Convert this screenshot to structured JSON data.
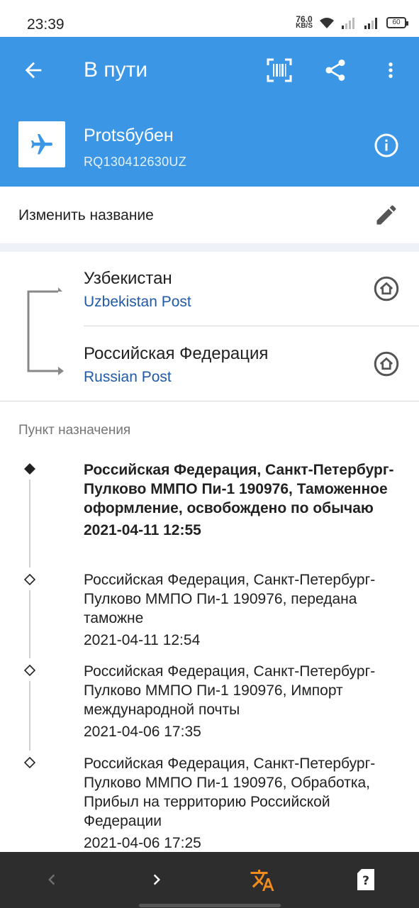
{
  "status_bar": {
    "time": "23:39",
    "net_speed_value": "76.0",
    "net_speed_unit": "KB/S",
    "battery": "60"
  },
  "header": {
    "title": "В пути",
    "package_name": "Protsбубен",
    "tracking_number": "RQ130412630UZ",
    "icons": [
      "back-arrow-icon",
      "barcode-scan-icon",
      "share-icon",
      "more-vert-icon",
      "airplane-icon",
      "info-icon"
    ]
  },
  "rename": {
    "label": "Изменить название"
  },
  "route": {
    "origin_country": "Узбекистан",
    "origin_post": "Uzbekistan Post",
    "destination_country": "Российская Федерация",
    "destination_post": "Russian Post"
  },
  "tracking": {
    "section_title": "Пункт назначения",
    "events": [
      {
        "location": "Российская Федерация, Санкт-Петербург-Пулково ММПО Пи-1 190976, Таможенное оформление, освобождено по обычаю",
        "time": "2021-04-11 12:55",
        "current": true
      },
      {
        "location": "Российская Федерация, Санкт-Петербург-Пулково ММПО Пи-1 190976, передана таможне",
        "time": "2021-04-11 12:54",
        "current": false
      },
      {
        "location": "Российская Федерация, Санкт-Петербург-Пулково ММПО Пи-1 190976, Импорт международной почты",
        "time": "2021-04-06 17:35",
        "current": false
      },
      {
        "location": "Российская Федерация, Санкт-Петербург-Пулково ММПО Пи-1 190976, Обработка, Прибыл на территорию Российской Федерации",
        "time": "2021-04-06 17:25",
        "current": false
      }
    ]
  },
  "colors": {
    "primary": "#3b97e6",
    "link": "#1f5aa8",
    "translate_accent": "#f08c1e",
    "bottom_bar": "#2d2d2d"
  }
}
